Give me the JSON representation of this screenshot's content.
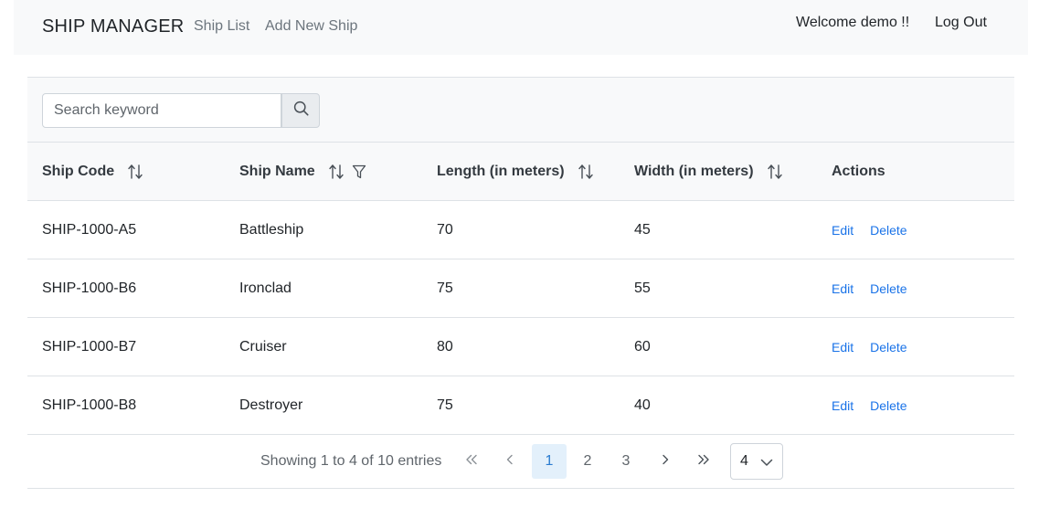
{
  "navbar": {
    "brand": "SHIP MANAGER",
    "links": [
      "Ship List",
      "Add New Ship"
    ],
    "welcome": "Welcome demo !!",
    "logout": "Log Out"
  },
  "search": {
    "placeholder": "Search keyword",
    "icon": "search-icon"
  },
  "table": {
    "columns": [
      "Ship Code",
      "Ship Name",
      "Length (in meters)",
      "Width (in meters)",
      "Actions"
    ],
    "rows": [
      {
        "code": "SHIP-1000-A5",
        "name": "Battleship",
        "length": "70",
        "width": "45"
      },
      {
        "code": "SHIP-1000-B6",
        "name": "Ironclad",
        "length": "75",
        "width": "55"
      },
      {
        "code": "SHIP-1000-B7",
        "name": "Cruiser",
        "length": "80",
        "width": "60"
      },
      {
        "code": "SHIP-1000-B8",
        "name": "Destroyer",
        "length": "75",
        "width": "40"
      }
    ],
    "actions": {
      "edit": "Edit",
      "delete": "Delete"
    }
  },
  "pagination": {
    "summary": "Showing 1 to 4 of 10 entries",
    "first": "«",
    "prev": "‹",
    "pages": [
      "1",
      "2",
      "3"
    ],
    "current_page": "1",
    "next": "›",
    "last": "»",
    "per_page": "4"
  },
  "colors": {
    "link": "#1a73e8",
    "active_page_bg": "#e3f0fb",
    "navbar_bg": "#f8f9fa"
  }
}
